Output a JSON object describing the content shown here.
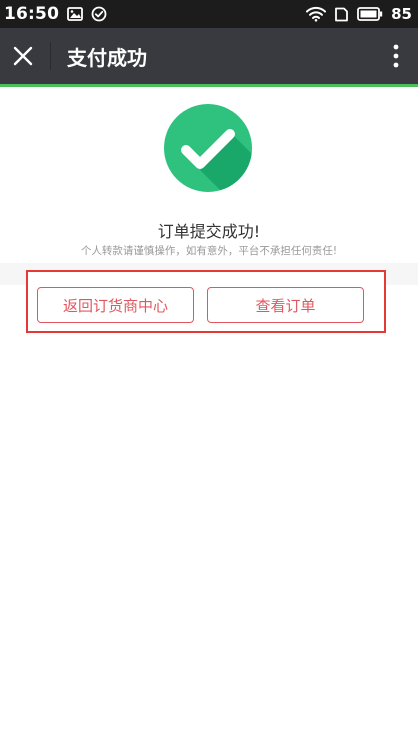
{
  "status_bar": {
    "time": "16:50",
    "battery_percent": "85",
    "icons": [
      "image-icon",
      "check-circle-icon",
      "wifi-icon",
      "sim-icon",
      "battery-icon"
    ]
  },
  "header": {
    "title": "支付成功",
    "close_icon": "close-icon",
    "more_icon": "more-vertical-icon",
    "background": "#393a3f"
  },
  "progress": {
    "percent": 100,
    "color": "#4cbe5c"
  },
  "result": {
    "icon": "check-circle-icon",
    "icon_color": "#2ec27e",
    "title": "订单提交成功!",
    "note": "个人转款请谨慎操作，如有意外，平台不承担任何责任!"
  },
  "actions": {
    "back_label": "返回订货商中心",
    "view_label": "查看订单",
    "button_color": "#e0585f",
    "highlight_color": "#e53935"
  }
}
